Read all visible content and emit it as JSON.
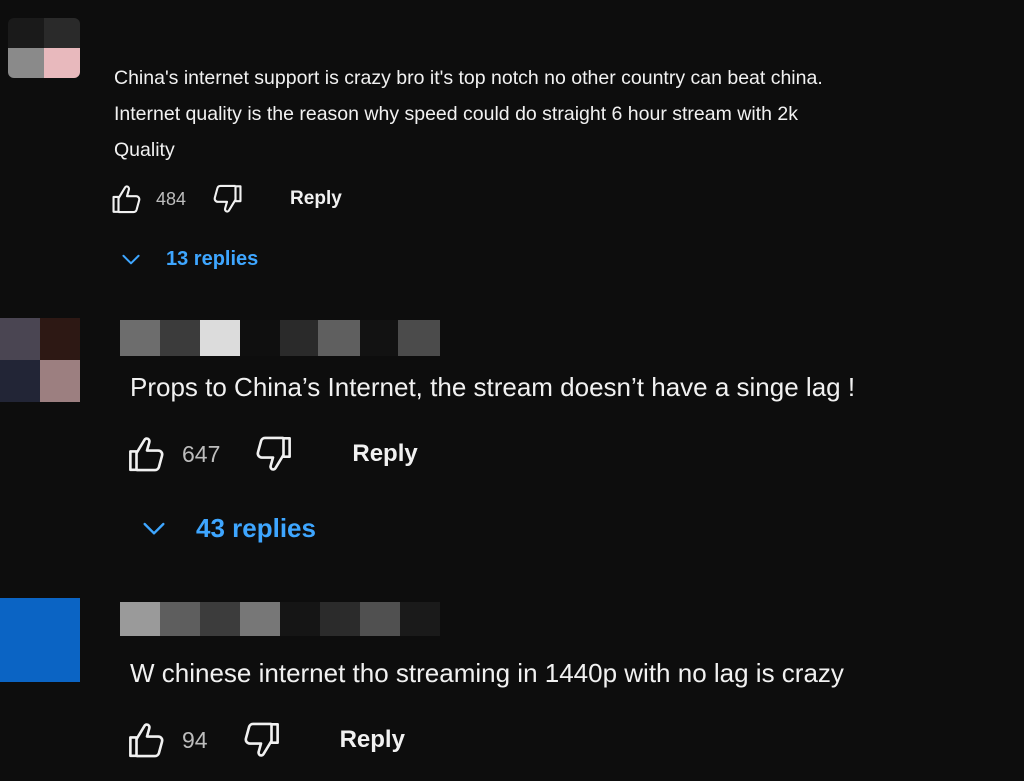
{
  "comments": [
    {
      "text": "China's internet support is crazy bro it's top notch no other country can beat china.\nInternet quality is the reason why speed could do straight 6 hour stream with 2k\nQuality",
      "likes": "484",
      "reply_label": "Reply",
      "replies_label": "13 replies",
      "like_icon": "thumbs-up-icon",
      "dislike_icon": "thumbs-down-icon",
      "chevron_icon": "chevron-down-icon"
    },
    {
      "text": "Props to China’s Internet, the stream doesn’t have a singe lag !",
      "likes": "647",
      "reply_label": "Reply",
      "replies_label": "43 replies",
      "like_icon": "thumbs-up-icon",
      "dislike_icon": "thumbs-down-icon",
      "chevron_icon": "chevron-down-icon"
    },
    {
      "text": "W chinese internet tho streaming in 1440p with no lag is crazy",
      "likes": "94",
      "reply_label": "Reply",
      "like_icon": "thumbs-up-icon",
      "dislike_icon": "thumbs-down-icon"
    }
  ],
  "colors": {
    "background": "#0d0d0d",
    "text": "#f1f1f1",
    "count": "#bdbdbd",
    "link": "#3ea6ff"
  }
}
